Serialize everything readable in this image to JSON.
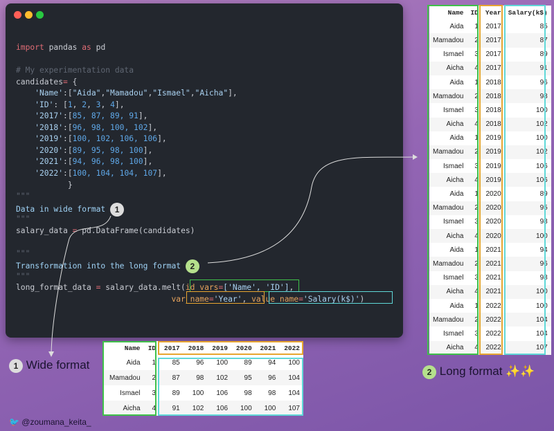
{
  "window": {
    "dots": [
      "#ff5f57",
      "#febc2e",
      "#28c840"
    ]
  },
  "code_lines": [
    [
      {
        "t": "import",
        "c": "kw"
      },
      {
        "t": " pandas ",
        "c": "pl"
      },
      {
        "t": "as",
        "c": "kw"
      },
      {
        "t": " pd",
        "c": "pl"
      }
    ],
    [],
    [
      {
        "t": "# My experimentation data",
        "c": "cm"
      }
    ],
    [
      {
        "t": "candidates",
        "c": "pl"
      },
      {
        "t": "=",
        "c": "op"
      },
      {
        "t": " {",
        "c": "pl"
      }
    ],
    [
      {
        "t": "    'Name'",
        "c": "st"
      },
      {
        "t": ":[",
        "c": "pl"
      },
      {
        "t": "\"Aida\"",
        "c": "st"
      },
      {
        "t": ",",
        "c": "pl"
      },
      {
        "t": "\"Mamadou\"",
        "c": "st"
      },
      {
        "t": ",",
        "c": "pl"
      },
      {
        "t": "\"Ismael\"",
        "c": "st"
      },
      {
        "t": ",",
        "c": "pl"
      },
      {
        "t": "\"Aicha\"",
        "c": "st"
      },
      {
        "t": "],",
        "c": "pl"
      }
    ],
    [
      {
        "t": "    'ID'",
        "c": "st"
      },
      {
        "t": ": [",
        "c": "pl"
      },
      {
        "t": "1",
        "c": "nu"
      },
      {
        "t": ", ",
        "c": "pl"
      },
      {
        "t": "2",
        "c": "nu"
      },
      {
        "t": ", ",
        "c": "pl"
      },
      {
        "t": "3",
        "c": "nu"
      },
      {
        "t": ", ",
        "c": "pl"
      },
      {
        "t": "4",
        "c": "nu"
      },
      {
        "t": "],",
        "c": "pl"
      }
    ],
    [
      {
        "t": "    '2017'",
        "c": "st"
      },
      {
        "t": ":[",
        "c": "pl"
      },
      {
        "t": "85, 87, 89, 91",
        "c": "nu"
      },
      {
        "t": "],",
        "c": "pl"
      }
    ],
    [
      {
        "t": "    '2018'",
        "c": "st"
      },
      {
        "t": ":[",
        "c": "pl"
      },
      {
        "t": "96, 98, 100, 102",
        "c": "nu"
      },
      {
        "t": "],",
        "c": "pl"
      }
    ],
    [
      {
        "t": "    '2019'",
        "c": "st"
      },
      {
        "t": ":[",
        "c": "pl"
      },
      {
        "t": "100, 102, 106, 106",
        "c": "nu"
      },
      {
        "t": "],",
        "c": "pl"
      }
    ],
    [
      {
        "t": "    '2020'",
        "c": "st"
      },
      {
        "t": ":[",
        "c": "pl"
      },
      {
        "t": "89, 95, 98, 100",
        "c": "nu"
      },
      {
        "t": "],",
        "c": "pl"
      }
    ],
    [
      {
        "t": "    '2021'",
        "c": "st"
      },
      {
        "t": ":[",
        "c": "pl"
      },
      {
        "t": "94, 96, 98, 100",
        "c": "nu"
      },
      {
        "t": "],",
        "c": "pl"
      }
    ],
    [
      {
        "t": "    '2022'",
        "c": "st"
      },
      {
        "t": ":[",
        "c": "pl"
      },
      {
        "t": "100, 104, 104, 107",
        "c": "nu"
      },
      {
        "t": "],",
        "c": "pl"
      }
    ],
    [
      {
        "t": "           }",
        "c": "pl"
      }
    ],
    [
      {
        "t": "\"\"\"",
        "c": "cm"
      }
    ],
    [
      {
        "t": "Data in wide format ",
        "c": "ds"
      },
      {
        "t": "1",
        "c": "badge1"
      }
    ],
    [
      {
        "t": "\"\"\"",
        "c": "cm"
      }
    ],
    [
      {
        "t": "salary_data ",
        "c": "pl"
      },
      {
        "t": "=",
        "c": "op"
      },
      {
        "t": " pd.DataFrame(candidates)",
        "c": "pl"
      }
    ],
    [],
    [
      {
        "t": "\"\"\"",
        "c": "cm"
      }
    ],
    [
      {
        "t": "Transformation into the long format ",
        "c": "ds"
      },
      {
        "t": "2",
        "c": "badge2"
      }
    ],
    [
      {
        "t": "\"\"\"",
        "c": "cm"
      }
    ],
    [
      {
        "t": "long_format_data ",
        "c": "pl"
      },
      {
        "t": "=",
        "c": "op"
      },
      {
        "t": " salary_data.melt(",
        "c": "pl"
      },
      {
        "t": "id_vars",
        "c": "hl"
      },
      {
        "t": "=",
        "c": "op"
      },
      {
        "t": "['Name', 'ID']",
        "c": "st"
      },
      {
        "t": ",",
        "c": "pl"
      }
    ],
    [
      {
        "t": "                                 var_name",
        "c": "hl"
      },
      {
        "t": "=",
        "c": "op"
      },
      {
        "t": "'Year'",
        "c": "st"
      },
      {
        "t": ", ",
        "c": "pl"
      },
      {
        "t": "value_name",
        "c": "hl"
      },
      {
        "t": "=",
        "c": "op"
      },
      {
        "t": "'Salary(k$)'",
        "c": "st"
      },
      {
        "t": ")",
        "c": "pl"
      }
    ]
  ],
  "long_table": {
    "headers": [
      "Name",
      "ID",
      "Year",
      "Salary(k$)"
    ],
    "rows": [
      [
        "Aida",
        "1",
        "2017",
        "85"
      ],
      [
        "Mamadou",
        "2",
        "2017",
        "87"
      ],
      [
        "Ismael",
        "3",
        "2017",
        "89"
      ],
      [
        "Aicha",
        "4",
        "2017",
        "91"
      ],
      [
        "Aida",
        "1",
        "2018",
        "96"
      ],
      [
        "Mamadou",
        "2",
        "2018",
        "98"
      ],
      [
        "Ismael",
        "3",
        "2018",
        "100"
      ],
      [
        "Aicha",
        "4",
        "2018",
        "102"
      ],
      [
        "Aida",
        "1",
        "2019",
        "100"
      ],
      [
        "Mamadou",
        "2",
        "2019",
        "102"
      ],
      [
        "Ismael",
        "3",
        "2019",
        "106"
      ],
      [
        "Aicha",
        "4",
        "2019",
        "106"
      ],
      [
        "Aida",
        "1",
        "2020",
        "89"
      ],
      [
        "Mamadou",
        "2",
        "2020",
        "95"
      ],
      [
        "Ismael",
        "3",
        "2020",
        "98"
      ],
      [
        "Aicha",
        "4",
        "2020",
        "100"
      ],
      [
        "Aida",
        "1",
        "2021",
        "94"
      ],
      [
        "Mamadou",
        "2",
        "2021",
        "96"
      ],
      [
        "Ismael",
        "3",
        "2021",
        "98"
      ],
      [
        "Aicha",
        "4",
        "2021",
        "100"
      ],
      [
        "Aida",
        "1",
        "2022",
        "100"
      ],
      [
        "Mamadou",
        "2",
        "2022",
        "104"
      ],
      [
        "Ismael",
        "3",
        "2022",
        "104"
      ],
      [
        "Aicha",
        "4",
        "2022",
        "107"
      ]
    ]
  },
  "wide_table": {
    "headers": [
      "Name",
      "ID",
      "2017",
      "2018",
      "2019",
      "2020",
      "2021",
      "2022"
    ],
    "rows": [
      [
        "Aida",
        "1",
        "85",
        "96",
        "100",
        "89",
        "94",
        "100"
      ],
      [
        "Mamadou",
        "2",
        "87",
        "98",
        "102",
        "95",
        "96",
        "104"
      ],
      [
        "Ismael",
        "3",
        "89",
        "100",
        "106",
        "98",
        "98",
        "104"
      ],
      [
        "Aicha",
        "4",
        "91",
        "102",
        "106",
        "100",
        "100",
        "107"
      ]
    ]
  },
  "labels": {
    "wide_num": "1",
    "wide": "Wide format",
    "long_num": "2",
    "long": "Long format ✨✨"
  },
  "footer": {
    "handle": "@zoumana_keita_"
  }
}
